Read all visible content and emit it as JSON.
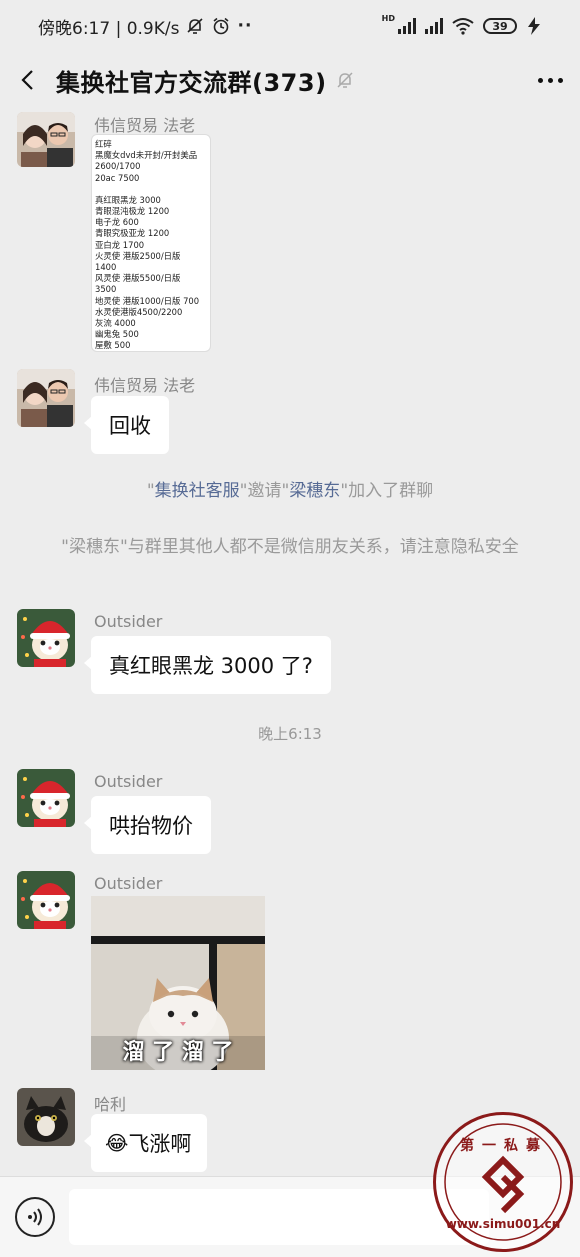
{
  "status_bar": {
    "time_speed": "傍晚6:17 | 0.9K/s",
    "network": "HD",
    "battery": "39"
  },
  "header": {
    "title": "集换社官方交流群(373)"
  },
  "messages": {
    "m1": {
      "sender": "伟信贸易 法老",
      "card_lines": [
        "红碎",
        "黑魔女dvd未开封/开封美品",
        " 2600/1700",
        "20ac 7500",
        "",
        "真红眼黑龙 3000",
        "青眼混沌极龙 1200",
        "电子龙 600",
        "青眼究极亚龙 1200",
        "亚白龙 1700",
        "火灵使 港版2500/日版",
        "1400",
        "风灵使 港版5500/日版",
        "3500",
        "地灵使 港版1000/日版 700",
        "水灵使港版4500/2200",
        "灰流 4000",
        "幽鬼兔 500",
        "屋敷 500"
      ]
    },
    "m2": {
      "sender": "伟信贸易 法老",
      "text": "回收"
    },
    "n1": {
      "q1": "\"",
      "name1": "集换社客服",
      "mid": "\"邀请\"",
      "name2": "梁穗东",
      "tail": "\"加入了群聊"
    },
    "n2": {
      "text": "\"梁穗东\"与群里其他人都不是微信朋友关系，请注意隐私安全"
    },
    "m3": {
      "sender": "Outsider",
      "text": "真红眼黑龙 3000 了?"
    },
    "time": "晚上6:13",
    "m4": {
      "sender": "Outsider",
      "text": "哄抬物价"
    },
    "m5": {
      "sender": "Outsider",
      "image_caption": "溜 了 溜 了"
    },
    "m6": {
      "sender": "哈利",
      "emoji": "😂",
      "text": "飞涨啊"
    }
  },
  "watermark": {
    "top": "第一私募",
    "bottom": "www.simu001.cn"
  },
  "colors": {
    "background": "#ededed",
    "bubble": "#ffffff",
    "link": "#576b95",
    "watermark": "#8b1a1a"
  }
}
